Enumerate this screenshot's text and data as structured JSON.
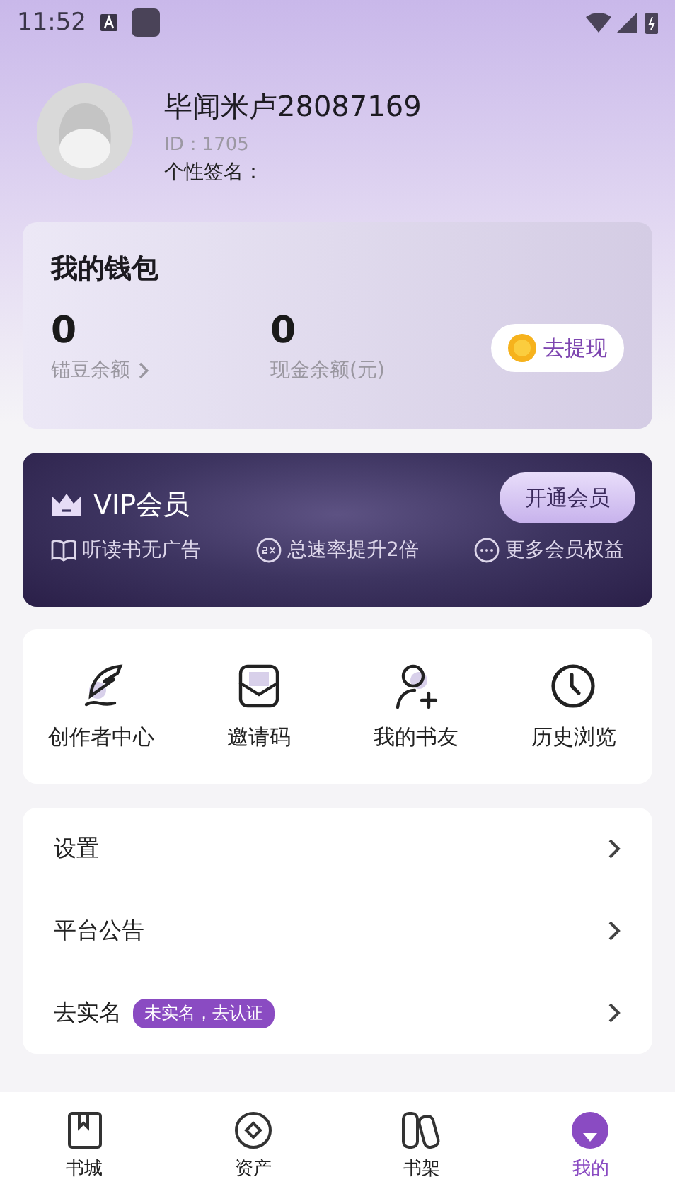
{
  "status_bar": {
    "time": "11:52"
  },
  "profile": {
    "name": "毕闻米卢28087169",
    "id": "ID：1705",
    "signature": "个性签名："
  },
  "wallet": {
    "title": "我的钱包",
    "balances": [
      {
        "value": "0",
        "label": "锚豆余额",
        "link": true
      },
      {
        "value": "0",
        "label": "现金余额(元)",
        "link": false
      }
    ],
    "withdraw": "去提现"
  },
  "vip": {
    "title": "VIP会员",
    "button": "开通会员",
    "perks": [
      {
        "kind": "book",
        "label": "听读书无广告"
      },
      {
        "kind": "speed",
        "label": "总速率提升2倍"
      },
      {
        "kind": "more",
        "label": "更多会员权益"
      }
    ]
  },
  "shortcuts": [
    {
      "kind": "feather",
      "label": "创作者中心"
    },
    {
      "kind": "envelope",
      "label": "邀请码"
    },
    {
      "kind": "friend",
      "label": "我的书友"
    },
    {
      "kind": "clock",
      "label": "历史浏览"
    }
  ],
  "menu": [
    {
      "label": "设置"
    },
    {
      "label": "平台公告"
    },
    {
      "label": "去实名",
      "badge": "未实名，去认证"
    }
  ],
  "tabs": [
    {
      "kind": "book",
      "label": "书城",
      "selected": false
    },
    {
      "kind": "coin",
      "label": "资产",
      "selected": false
    },
    {
      "kind": "shelf",
      "label": "书架",
      "selected": false
    },
    {
      "kind": "me",
      "label": "我的",
      "selected": true
    }
  ]
}
